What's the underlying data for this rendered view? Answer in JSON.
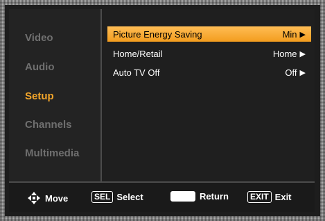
{
  "sidebar": {
    "items": [
      {
        "label": "Video",
        "active": false
      },
      {
        "label": "Audio",
        "active": false
      },
      {
        "label": "Setup",
        "active": true
      },
      {
        "label": "Channels",
        "active": false
      },
      {
        "label": "Multimedia",
        "active": false
      }
    ]
  },
  "settings": {
    "rows": [
      {
        "label": "Picture Energy Saving",
        "value": "Min",
        "selected": true
      },
      {
        "label": "Home/Retail",
        "value": "Home",
        "selected": false
      },
      {
        "label": "Auto TV Off",
        "value": "Off",
        "selected": false
      }
    ],
    "arrow_glyph": "▶"
  },
  "footer": {
    "move_label": "Move",
    "select_key": "SEL",
    "select_label": "Select",
    "return_label": "Return",
    "exit_key": "EXIT",
    "exit_label": "Exit"
  },
  "colors": {
    "accent": "#f2a52a",
    "highlight": "#fbb040",
    "background": "#1d1d1d",
    "inactive_text": "#6f6f6f"
  },
  "icons": {
    "move": "four-way-arrow-icon",
    "return": "return-key-icon"
  }
}
